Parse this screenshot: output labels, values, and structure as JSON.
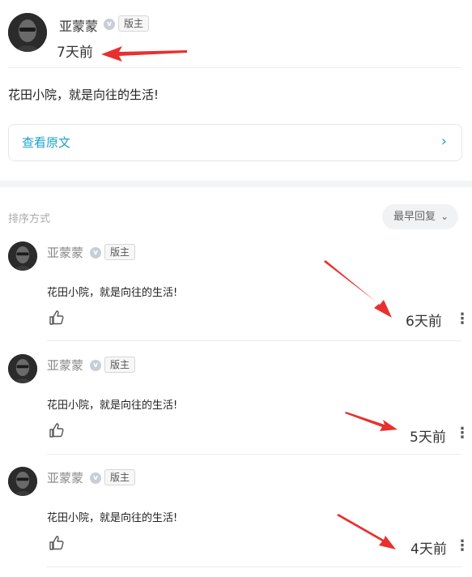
{
  "post": {
    "author_name": "亚蒙蒙",
    "author_badge": "版主",
    "time": "7天前",
    "content": "花田小院，就是向往的生活!",
    "view_original": "查看原文",
    "chevron": "›"
  },
  "comments_header": {
    "sort_label": "排序方式",
    "sort_value": "最早回复",
    "sort_chevron": "⌄"
  },
  "comments": [
    {
      "name": "亚蒙蒙",
      "badge": "版主",
      "text": "花田小院，就是向往的生活!",
      "time": "6天前",
      "more": "⋮"
    },
    {
      "name": "亚蒙蒙",
      "badge": "版主",
      "text": "花田小院，就是向往的生活!",
      "time": "5天前",
      "more": "⋮"
    },
    {
      "name": "亚蒙蒙",
      "badge": "版主",
      "text": "花田小院，就是向往的生活!",
      "time": "4天前",
      "more": "⋮"
    }
  ],
  "icons": {
    "verified_badge": "v",
    "like": "thumbs-up-icon",
    "annotation_arrow": "red-arrow-icon"
  },
  "colors": {
    "link": "#1aa3c8",
    "arrow": "#e8302f",
    "divider": "#ececec",
    "band": "#f3f4f6"
  }
}
